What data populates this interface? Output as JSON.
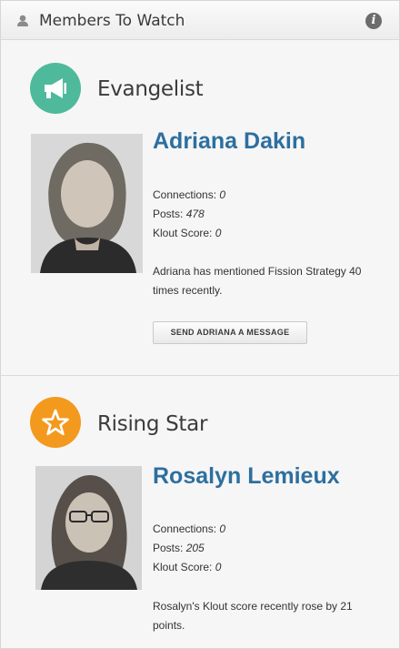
{
  "widget": {
    "title": "Members To Watch"
  },
  "members": [
    {
      "role": "Evangelist",
      "badge_color": "#4fb99b",
      "badge_icon": "megaphone-icon",
      "name": "Adriana Dakin",
      "connections_label": "Connections:",
      "connections": "0",
      "posts_label": "Posts:",
      "posts": "478",
      "klout_label": "Klout Score:",
      "klout": "0",
      "description": "Adriana has mentioned Fission Strategy 40 times recently.",
      "button_label": "SEND ADRIANA A MESSAGE"
    },
    {
      "role": "Rising Star",
      "badge_color": "#f39a1e",
      "badge_icon": "star-icon",
      "name": "Rosalyn Lemieux",
      "connections_label": "Connections:",
      "connections": "0",
      "posts_label": "Posts:",
      "posts": "205",
      "klout_label": "Klout Score:",
      "klout": "0",
      "description": "Rosalyn's Klout score recently rose by 21 points."
    }
  ]
}
